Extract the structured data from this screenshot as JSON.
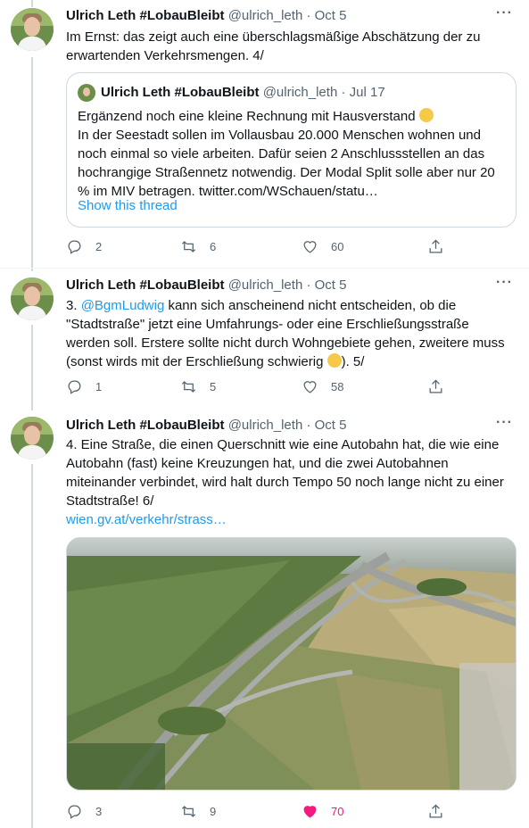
{
  "tweets": [
    {
      "name": "Ulrich Leth #LobauBleibt",
      "handle": "@ulrich_leth",
      "date": "· Oct 5",
      "text": "Im Ernst: das zeigt auch eine überschlagsmäßige Abschätzung der zu erwartenden Verkehrsmengen. 4/",
      "quote": {
        "name": "Ulrich Leth #LobauBleibt",
        "handle": "@ulrich_leth",
        "date": "· Jul 17",
        "line1": "Ergänzend noch eine kleine Rechnung mit Hausverstand",
        "line1_emoji": "winking-face",
        "text": "In der Seestadt sollen im Vollausbau 20.000 Menschen wohnen und noch einmal so viele arbeiten. Dafür seien 2 Anschlussstellen an das hochrangige Straßennetz notwendig. Der Modal Split solle aber nur 20 % im MIV betragen. twitter.com/WSchauen/statu…",
        "show_thread": "Show this thread"
      },
      "replies": "2",
      "retweets": "6",
      "likes": "60"
    },
    {
      "name": "Ulrich Leth #LobauBleibt",
      "handle": "@ulrich_leth",
      "date": "· Oct 5",
      "prefix": "3. ",
      "mention": "@BgmLudwig",
      "text": " kann sich anscheinend nicht entscheiden, ob die \"Stadtstraße\" jetzt eine Umfahrungs- oder eine Erschließungsstraße werden soll. Erstere sollte nicht durch Wohngebiete gehen, zweitere muss (sonst wirds mit der Erschließung schwierig ",
      "suffix": "). 5/",
      "emoji": "shushing-face",
      "replies": "1",
      "retweets": "5",
      "likes": "58"
    },
    {
      "name": "Ulrich Leth #LobauBleibt",
      "handle": "@ulrich_leth",
      "date": "· Oct 5",
      "text": "4. Eine Straße, die einen Querschnitt wie eine Autobahn hat, die wie eine Autobahn (fast) keine Kreuzungen hat, und die zwei Autobahnen miteinander verbindet, wird halt durch Tempo 50 noch lange nicht zu einer Stadtstraße! 6/",
      "link": "wien.gv.at/verkehr/strass…",
      "replies": "3",
      "retweets": "9",
      "likes": "70",
      "liked": true
    }
  ],
  "icons": {
    "more": "more-icon",
    "reply": "reply-icon",
    "retweet": "retweet-icon",
    "like": "heart-icon",
    "share": "share-icon"
  },
  "colors": {
    "accent": "#1d9bf0",
    "like_active": "#f91880",
    "muted": "#536471"
  }
}
